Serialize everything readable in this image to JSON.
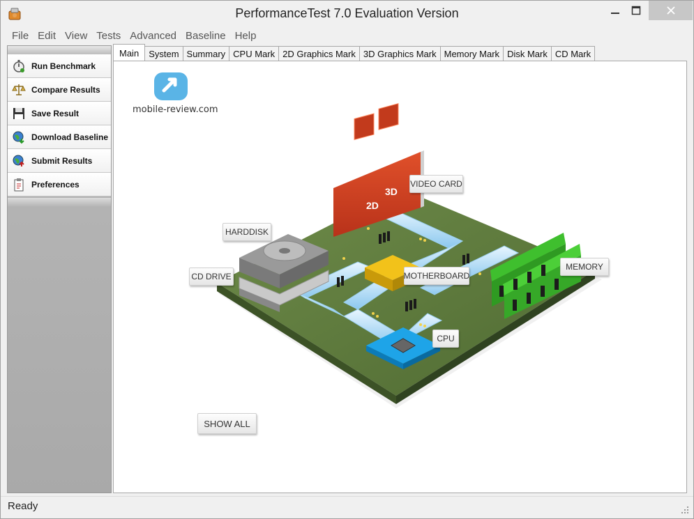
{
  "window": {
    "title": "PerformanceTest 7.0 Evaluation Version"
  },
  "menu": [
    "File",
    "Edit",
    "View",
    "Tests",
    "Advanced",
    "Baseline",
    "Help"
  ],
  "sidebar": {
    "items": [
      {
        "label": "Run Benchmark",
        "icon": "stopwatch-icon"
      },
      {
        "label": "Compare Results",
        "icon": "scales-icon"
      },
      {
        "label": "Save Result",
        "icon": "floppy-icon"
      },
      {
        "label": "Download Baseline",
        "icon": "globe-download-icon"
      },
      {
        "label": "Submit Results",
        "icon": "globe-upload-icon"
      },
      {
        "label": "Preferences",
        "icon": "clipboard-icon"
      }
    ]
  },
  "tabs": [
    "Main",
    "System",
    "Summary",
    "CPU Mark",
    "2D Graphics Mark",
    "3D Graphics Mark",
    "Memory Mark",
    "Disk Mark",
    "CD Mark"
  ],
  "watermark": {
    "text": "mobile-review.com"
  },
  "diagram": {
    "video_card": "VIDEO CARD",
    "harddisk": "HARDDISK",
    "cd_drive": "CD DRIVE",
    "motherboard": "MOTHERBOARD",
    "memory": "MEMORY",
    "cpu": "CPU",
    "badge_2d": "2D",
    "badge_3d": "3D"
  },
  "show_all": "SHOW ALL",
  "status": {
    "text": "Ready"
  }
}
